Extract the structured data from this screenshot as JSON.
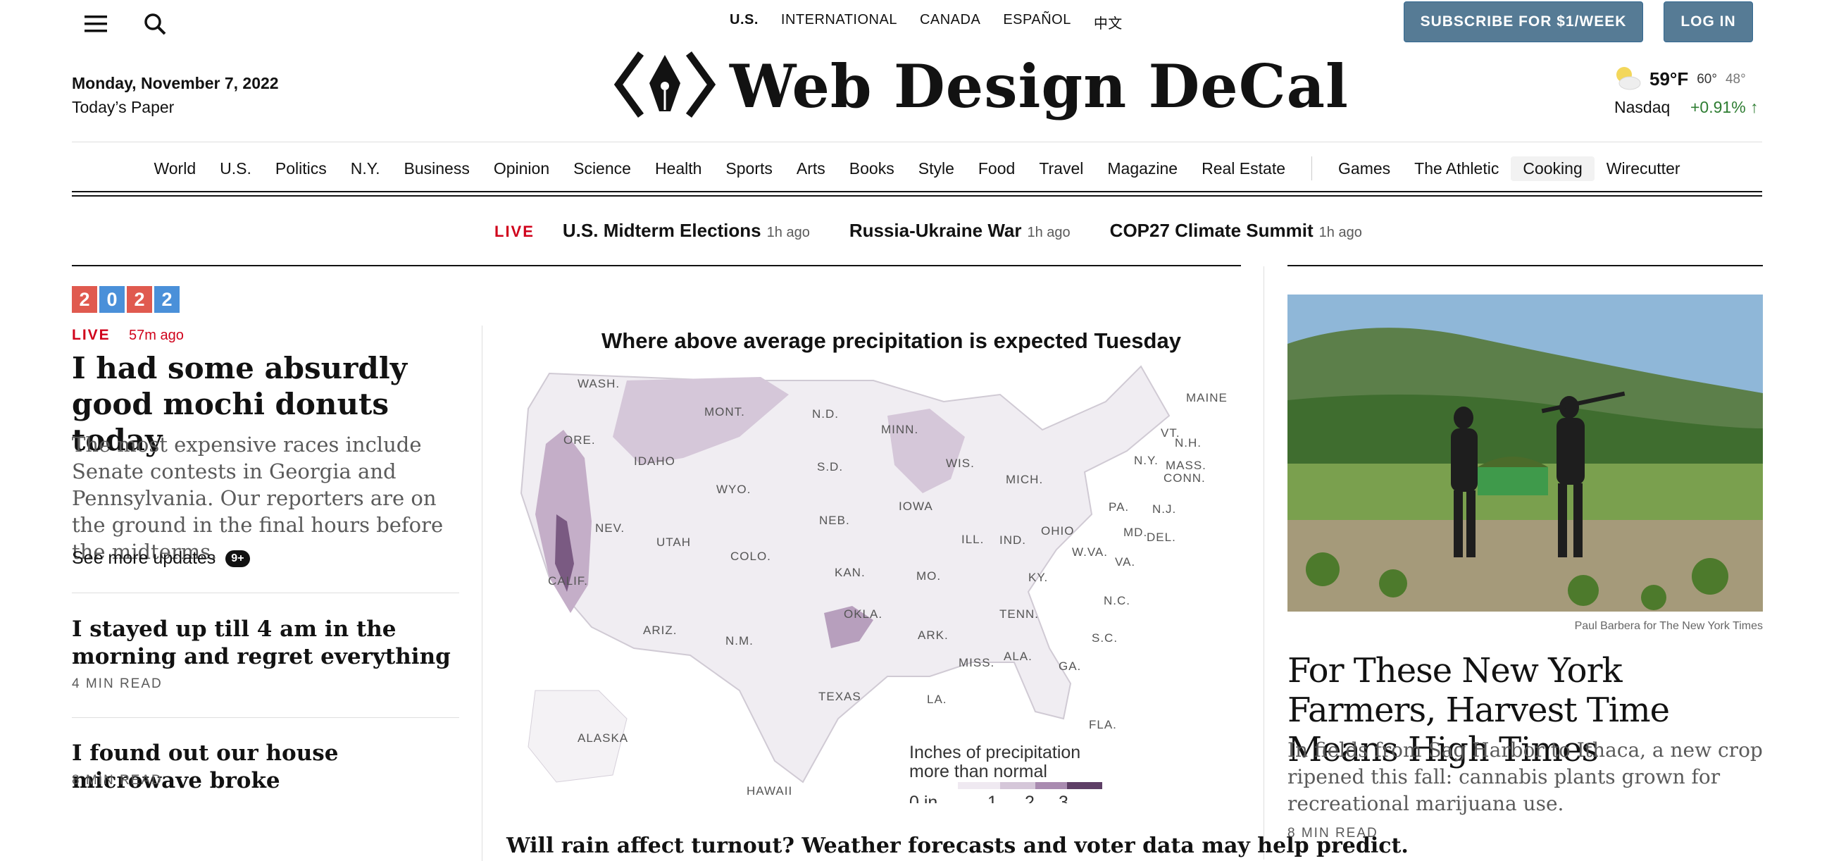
{
  "header": {
    "editions": [
      "U.S.",
      "INTERNATIONAL",
      "CANADA",
      "ESPAÑOL",
      "中文"
    ],
    "subscribe_label": "SUBSCRIBE FOR $1/WEEK",
    "login_label": "LOG IN",
    "date": "Monday, November 7, 2022",
    "todays_paper": "Today’s Paper",
    "masthead_title": "Web Design DeCal",
    "weather": {
      "temp": "59°F",
      "high": "60°",
      "low": "48°"
    },
    "market": {
      "name": "Nasdaq",
      "change": "+0.91%"
    }
  },
  "nav": {
    "sections": [
      "World",
      "U.S.",
      "Politics",
      "N.Y.",
      "Business",
      "Opinion",
      "Science",
      "Health",
      "Sports",
      "Arts",
      "Books",
      "Style",
      "Food",
      "Travel",
      "Magazine",
      "Real Estate"
    ],
    "products": [
      "Games",
      "The Athletic",
      "Cooking",
      "Wirecutter"
    ]
  },
  "ticker": {
    "live_label": "LIVE",
    "items": [
      {
        "title": "U.S. Midterm Elections",
        "time": "1h ago"
      },
      {
        "title": "Russia-Ukraine War",
        "time": "1h ago"
      },
      {
        "title": "COP27 Climate Summit",
        "time": "1h ago"
      }
    ]
  },
  "lead": {
    "badge_digits": [
      "2",
      "0",
      "2",
      "2"
    ],
    "live_label": "LIVE",
    "time": "57m ago",
    "headline": "I had some absurdly good mochi donuts today",
    "summary": "The most expensive races include Senate contests in Georgia and Pennsylvania. Our reporters are on the ground in the final hours before the midterms.",
    "see_more": "See more updates",
    "count": "9+"
  },
  "stories": [
    {
      "headline": "I stayed up till 4 am in the morning and regret everything",
      "read_time": "4 MIN READ"
    },
    {
      "headline": "I found out our house microwave broke",
      "read_time": "8 MIN READ"
    }
  ],
  "map": {
    "title": "Where above average precipitation is expected Tuesday",
    "legend_title_1": "Inches of precipitation",
    "legend_title_2": "more than normal",
    "legend_ticks": [
      "0 in.",
      "1",
      "2",
      "3"
    ],
    "state_labels": [
      "WASH.",
      "ORE.",
      "CALIF.",
      "NEV.",
      "IDAHO",
      "MONT.",
      "WYO.",
      "UTAH",
      "ARIZ.",
      "COLO.",
      "N.M.",
      "N.D.",
      "S.D.",
      "NEB.",
      "KAN.",
      "OKLA.",
      "TEXAS",
      "MINN.",
      "IOWA",
      "MO.",
      "ARK.",
      "LA.",
      "WIS.",
      "ILL.",
      "MICH.",
      "IND.",
      "OHIO",
      "KY.",
      "TENN.",
      "MISS.",
      "ALA.",
      "GA.",
      "FLA.",
      "S.C.",
      "N.C.",
      "VA.",
      "W.VA.",
      "PA.",
      "N.Y.",
      "MAINE",
      "VT.",
      "N.H.",
      "MASS.",
      "CONN.",
      "N.J.",
      "DEL.",
      "MD.",
      "ALASKA",
      "HAWAII"
    ],
    "caption": "Will rain affect turnout? Weather forecasts and voter data may help predict.",
    "colors": {
      "light": "#e7e1ea",
      "mid": "#c4aec8",
      "dark": "#7a5a82"
    }
  },
  "right": {
    "photo_credit": "Paul Barbera for The New York Times",
    "headline": "For These New York Farmers, Harvest Time Means High Times",
    "summary": "In fields from Sag Harbor to Ithaca, a new crop ripened this fall: cannabis plants grown for recreational marijuana use.",
    "read_time": "8 MIN READ"
  },
  "colors": {
    "live_red": "#d0021b",
    "subscribe_blue": "#567b95",
    "gain_green": "#2e7d32",
    "badge_red": "#e05a4f",
    "badge_blue": "#4a90d9"
  }
}
